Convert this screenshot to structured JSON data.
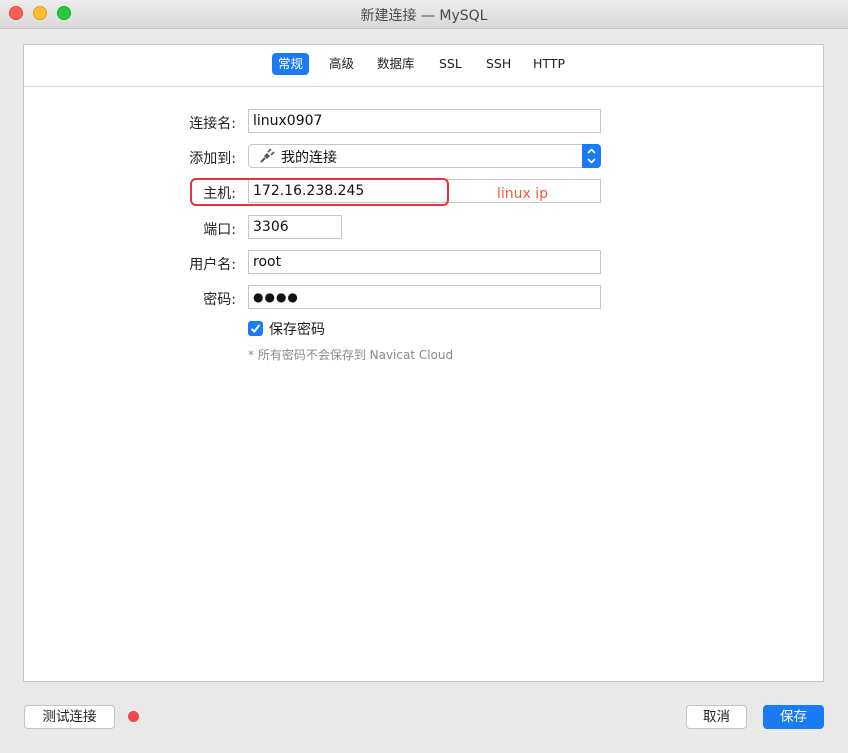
{
  "window": {
    "title": "新建连接 — MySQL"
  },
  "tabs": [
    {
      "label": "常规",
      "active": true
    },
    {
      "label": "高级",
      "active": false
    },
    {
      "label": "数据库",
      "active": false
    },
    {
      "label": "SSL",
      "active": false
    },
    {
      "label": "SSH",
      "active": false
    },
    {
      "label": "HTTP",
      "active": false
    }
  ],
  "form": {
    "connection_name": {
      "label": "连接名:",
      "value": "linux0907"
    },
    "add_to": {
      "label": "添加到:",
      "value": "我的连接",
      "icon": "plug-icon"
    },
    "host": {
      "label": "主机:",
      "value": "172.16.238.245"
    },
    "port": {
      "label": "端口:",
      "value": "3306"
    },
    "username": {
      "label": "用户名:",
      "value": "root"
    },
    "password": {
      "label": "密码:",
      "value": "●●●●"
    },
    "save_password": {
      "label": "保存密码",
      "checked": true
    },
    "note": "* 所有密码不会保存到 Navicat Cloud"
  },
  "annotation": {
    "text": "linux  ip",
    "color": "#f05a3c",
    "highlight_color": "#e8333c"
  },
  "footer": {
    "test_button": "测试连接",
    "status_color": "#f0474a",
    "cancel_button": "取消",
    "save_button": "保存"
  },
  "colors": {
    "accent": "#1a7cf5"
  }
}
